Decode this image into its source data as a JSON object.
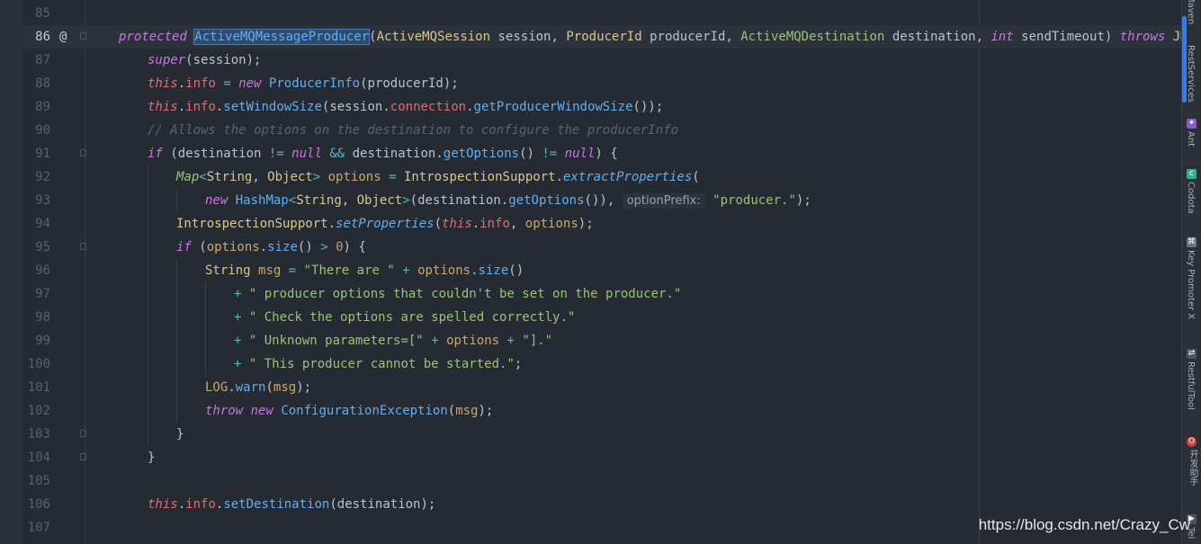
{
  "editor": {
    "current_line": 86,
    "line_numbers": [
      "85",
      "86",
      "87",
      "88",
      "89",
      "90",
      "91",
      "92",
      "93",
      "94",
      "95",
      "96",
      "97",
      "98",
      "99",
      "100",
      "101",
      "102",
      "103",
      "104",
      "105",
      "106",
      "107"
    ],
    "gutter_marker": "@",
    "param_hint": "optionPrefix:",
    "tokens": {
      "protected": "protected",
      "class_name": "ActiveMQMessageProducer",
      "session_type": "ActiveMQSession",
      "session": "session",
      "producer_id_type": "ProducerId",
      "producer_id": "producerId",
      "dest_type": "ActiveMQDestination",
      "destination": "destination",
      "int": "int",
      "send_timeout": "sendTimeout",
      "throws": "throws",
      "jms_exc": "JMSExcepti",
      "super": "super",
      "this": "this",
      "info": "info",
      "new": "new",
      "producer_info": "ProducerInfo",
      "set_window_size": "setWindowSize",
      "connection": "connection",
      "get_pws": "getProducerWindowSize",
      "comment": "// Allows the options on the destination to configure the producerInfo",
      "if": "if",
      "null": "null",
      "get_options": "getOptions",
      "map": "Map",
      "string": "String",
      "object": "Object",
      "options": "options",
      "introspection": "IntrospectionSupport",
      "extract_props": "extractProperties",
      "hashmap": "HashMap",
      "producer_str": "\"producer.\"",
      "set_props": "setProperties",
      "size": "size",
      "zero": "0",
      "msg": "msg",
      "str1": "\"There are \"",
      "str2": "\" producer options that couldn't be set on the producer.\"",
      "str3": "\" Check the options are spelled correctly.\"",
      "str4": "\" Unknown parameters=[\"",
      "str5": "\"].\"",
      "str6": "\" This producer cannot be started.\"",
      "log": "LOG",
      "warn": "warn",
      "throw": "throw",
      "config_exc": "ConfigurationException",
      "set_destination": "setDestination"
    }
  },
  "right_toolbar": {
    "items": [
      {
        "label": "Maven",
        "icon": "maven-icon"
      },
      {
        "label": "RestServices",
        "icon": "rest-services-icon"
      },
      {
        "label": "Ant",
        "icon": "ant-icon"
      },
      {
        "label": "Codota",
        "icon": "codota-icon"
      },
      {
        "label": "Key Promoter X",
        "icon": "key-promoter-icon"
      },
      {
        "label": "RestfulTool",
        "icon": "restful-tool-icon"
      },
      {
        "label": "开发助手",
        "icon": "dev-helper-icon"
      },
      {
        "label": "Tel",
        "icon": "tel-icon"
      }
    ]
  },
  "watermark": "https://blog.csdn.net/Crazy_Cw",
  "colors": {
    "background": "#262a33",
    "keyword": "#c678dd",
    "string": "#98c379",
    "method": "#61afef",
    "field": "#e06c75",
    "type": "#d7c98b"
  }
}
